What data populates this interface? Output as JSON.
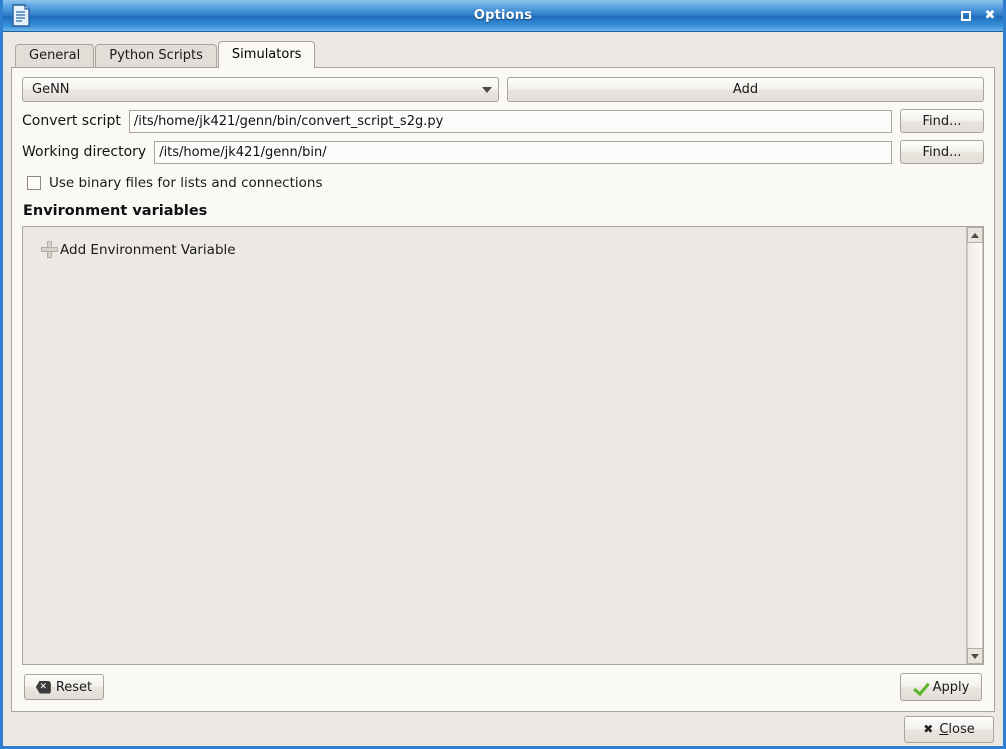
{
  "window": {
    "title": "Options",
    "icon": "document-properties-icon",
    "controls": {
      "maximize": "maximize-button",
      "close": "close-button"
    }
  },
  "tabs": [
    {
      "label": "General",
      "active": false
    },
    {
      "label": "Python Scripts",
      "active": false
    },
    {
      "label": "Simulators",
      "active": true
    }
  ],
  "simulators": {
    "selector": {
      "value": "GeNN",
      "caret": "chevron-down-icon"
    },
    "add_button": "Add",
    "convert_script": {
      "label": "Convert script",
      "value": "/its/home/jk421/genn/bin/convert_script_s2g.py",
      "find_button": "Find..."
    },
    "working_directory": {
      "label": "Working directory",
      "value": "/its/home/jk421/genn/bin/",
      "find_button": "Find..."
    },
    "binary_files_checkbox": {
      "label": "Use binary files for lists and connections",
      "checked": false
    },
    "environment": {
      "title": "Environment variables",
      "add_item": "Add Environment Variable",
      "add_item_icon": "plus-icon",
      "items": []
    },
    "reset_button": "Reset",
    "apply_button": "Apply"
  },
  "footer": {
    "close_button_mnemonic": "C",
    "close_button_rest": "lose"
  },
  "colors": {
    "titlebar_blue": "#2d7cc9",
    "window_border": "#2f7fd0",
    "panel_bg": "#fbf9f6",
    "dialog_bg": "#ece9e4",
    "accent_green": "#5cb82b"
  }
}
